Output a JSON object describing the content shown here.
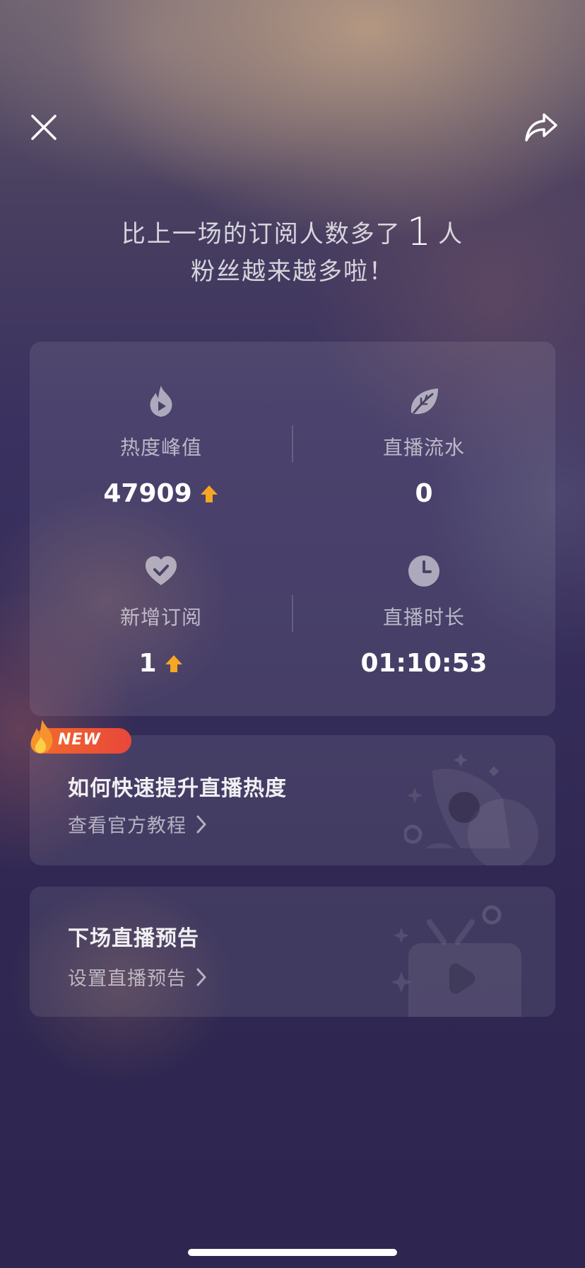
{
  "header": {
    "close_icon": "close-icon",
    "share_icon": "share-icon"
  },
  "headline": {
    "line1_prefix": "比上一场的订阅人数多了",
    "line1_number": "1",
    "line1_suffix": "人",
    "line2": "粉丝越来越多啦！"
  },
  "stats": [
    {
      "icon": "flame-play-icon",
      "label": "热度峰值",
      "value": "47909",
      "trend": "up"
    },
    {
      "icon": "leaf-icon",
      "label": "直播流水",
      "value": "0",
      "trend": "none"
    },
    {
      "icon": "heart-check-icon",
      "label": "新增订阅",
      "value": "1",
      "trend": "up"
    },
    {
      "icon": "clock-icon",
      "label": "直播时长",
      "value": "01:10:53",
      "trend": "none"
    }
  ],
  "colors": {
    "accent_arrow": "#f5a623",
    "badge_start": "#f26a2b",
    "badge_end": "#e8473a",
    "background": "#2f2750"
  },
  "promo1": {
    "badge": "NEW",
    "title": "如何快速提升直播热度",
    "link": "查看官方教程",
    "illustration": "rocket-illustration"
  },
  "promo2": {
    "title": "下场直播预告",
    "link": "设置直播预告",
    "illustration": "tv-illustration"
  }
}
